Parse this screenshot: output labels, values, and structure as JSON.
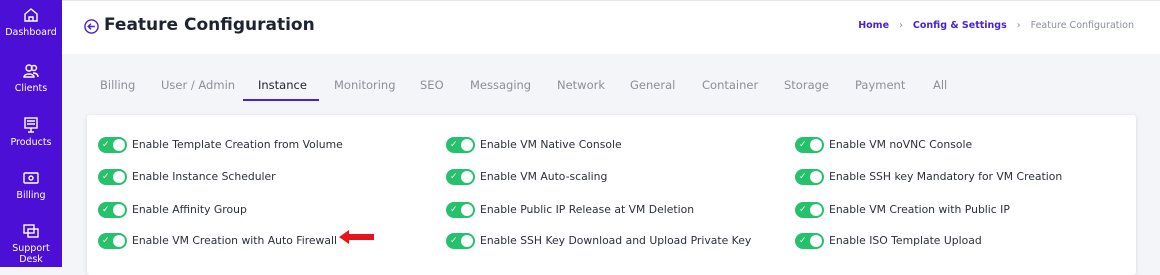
{
  "sidebar": {
    "items": [
      {
        "label": "Dashboard",
        "icon": "home-icon"
      },
      {
        "label": "Clients",
        "icon": "users-icon"
      },
      {
        "label": "Products",
        "icon": "products-icon"
      },
      {
        "label": "Billing",
        "icon": "billing-icon"
      },
      {
        "label": "Support Desk",
        "icon": "support-icon"
      }
    ]
  },
  "header": {
    "title": "Feature Configuration",
    "breadcrumb": [
      "Home",
      "Config & Settings",
      "Feature Configuration"
    ]
  },
  "tabs": [
    "Billing",
    "User / Admin",
    "Instance",
    "Monitoring",
    "SEO",
    "Messaging",
    "Network",
    "General",
    "Container",
    "Storage",
    "Payment",
    "All"
  ],
  "active_tab": "Instance",
  "options": [
    {
      "label": "Enable Template Creation from Volume",
      "enabled": true
    },
    {
      "label": "Enable VM Native Console",
      "enabled": true
    },
    {
      "label": "Enable VM noVNC Console",
      "enabled": true
    },
    {
      "label": "Enable Instance Scheduler",
      "enabled": true
    },
    {
      "label": "Enable VM Auto-scaling",
      "enabled": true
    },
    {
      "label": "Enable SSH key Mandatory for VM Creation",
      "enabled": true
    },
    {
      "label": "Enable Affinity Group",
      "enabled": true
    },
    {
      "label": "Enable Public IP Release at VM Deletion",
      "enabled": true
    },
    {
      "label": "Enable VM Creation with Public IP",
      "enabled": true
    },
    {
      "label": "Enable VM Creation with Auto Firewall",
      "enabled": true
    },
    {
      "label": "Enable SSH Key Download and Upload Private Key",
      "enabled": true
    },
    {
      "label": "Enable ISO Template Upload",
      "enabled": true
    }
  ],
  "colors": {
    "sidebar": "#4b0fd6",
    "accent": "#4b1fd6",
    "toggle_on": "#25c26b",
    "annotation_arrow": "#e8141c"
  }
}
